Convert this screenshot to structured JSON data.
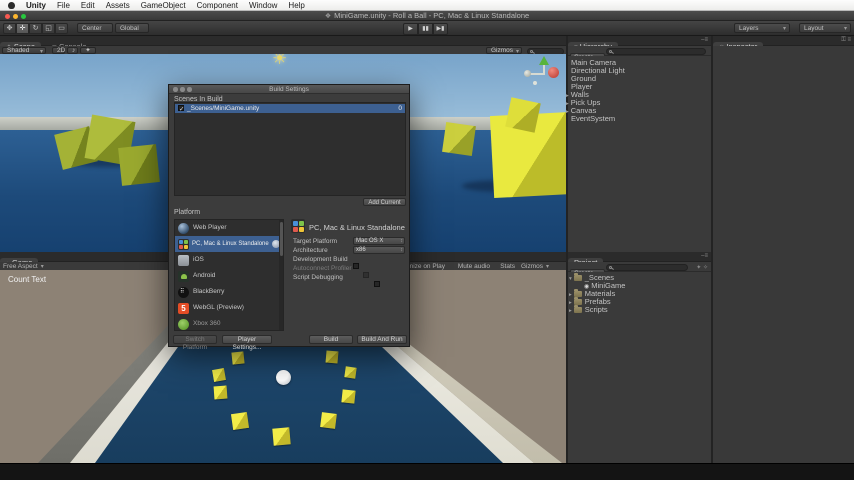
{
  "menu_bar": {
    "items": [
      "Unity",
      "File",
      "Edit",
      "Assets",
      "GameObject",
      "Component",
      "Window",
      "Help"
    ]
  },
  "window": {
    "title": "MiniGame.unity - Roll a Ball - PC, Mac & Linux Standalone"
  },
  "toolbar": {
    "center_label": "Center",
    "global_label": "Global",
    "layers_label": "Layers",
    "layout_label": "Layout",
    "transport": {
      "play": "▶",
      "pause": "▮▮",
      "step": "▶▮"
    },
    "tools": {
      "pan": "✥",
      "move": "✛",
      "rotate": "↻",
      "scale": "◱",
      "rect": "▭"
    }
  },
  "scene_panel": {
    "tab_scene": "Scene",
    "tab_console": "Console",
    "shaded_label": "Shaded",
    "toggle_2d": "2D",
    "audio_icon": "♪",
    "effects_icon": "✦",
    "gizmos_label": "Gizmos"
  },
  "game_panel": {
    "tab": "Game",
    "aspect": "Free Aspect",
    "maximize_label": "Maximize on Play",
    "mute_label": "Mute audio",
    "stats_label": "Stats",
    "gizmos_label": "Gizmos",
    "count_text": "Count Text"
  },
  "hierarchy": {
    "tab": "Hierarchy",
    "create_label": "Create",
    "items": [
      {
        "label": "Main Camera",
        "arrow": ""
      },
      {
        "label": "Directional Light",
        "arrow": ""
      },
      {
        "label": "Ground",
        "arrow": ""
      },
      {
        "label": "Player",
        "arrow": ""
      },
      {
        "label": "Walls",
        "arrow": "▸"
      },
      {
        "label": "Pick Ups",
        "arrow": "▸"
      },
      {
        "label": "Canvas",
        "arrow": "▸"
      },
      {
        "label": "EventSystem",
        "arrow": ""
      }
    ]
  },
  "project": {
    "tab": "Project",
    "create_label": "Create",
    "items": [
      {
        "label": "_Scenes",
        "arrow": "▾",
        "icon": "folder"
      },
      {
        "label": "MiniGame",
        "arrow": "",
        "icon": "scene"
      },
      {
        "label": "Materials",
        "arrow": "▸",
        "icon": "folder"
      },
      {
        "label": "Prefabs",
        "arrow": "▸",
        "icon": "folder"
      },
      {
        "label": "Scripts",
        "arrow": "▸",
        "icon": "folder"
      }
    ]
  },
  "inspector": {
    "tab": "Inspector"
  },
  "build_dialog": {
    "title": "Build Settings",
    "scenes_in_build_label": "Scenes In Build",
    "scenes": [
      {
        "name": "_Scenes/MiniGame.unity",
        "index": "0",
        "checked": true
      }
    ],
    "add_current_label": "Add Current",
    "platform_label": "Platform",
    "platforms": [
      {
        "name": "Web Player",
        "selected": false
      },
      {
        "name": "PC, Mac & Linux Standalone",
        "selected": true
      },
      {
        "name": "iOS",
        "selected": false
      },
      {
        "name": "Android",
        "selected": false
      },
      {
        "name": "BlackBerry",
        "selected": false
      },
      {
        "name": "WebGL (Preview)",
        "selected": false
      },
      {
        "name": "Xbox 360",
        "selected": false
      }
    ],
    "selected_platform_title": "PC, Mac & Linux Standalone",
    "settings": [
      {
        "label": "Target Platform",
        "value": "Mac OS X",
        "type": "dropdown"
      },
      {
        "label": "Architecture",
        "value": "x86",
        "type": "dropdown"
      },
      {
        "label": "Development Build",
        "value": "",
        "type": "checkbox"
      },
      {
        "label": "Autoconnect Profiler",
        "value": "",
        "type": "checkbox_disabled"
      },
      {
        "label": "Script Debugging",
        "value": "",
        "type": "checkbox"
      }
    ],
    "buttons": {
      "switch_platform": "Switch Platform",
      "player_settings": "Player Settings...",
      "build": "Build",
      "build_and_run": "Build And Run"
    }
  },
  "colors": {
    "selection_blue": "#3d6091",
    "sky_blue": "#78a4ca",
    "ground_blue": "#1d4a7a",
    "pickup_yellow": "#f2ec48",
    "game_bg_brown": "#8d8275",
    "webgl_orange": "#e44d26"
  }
}
